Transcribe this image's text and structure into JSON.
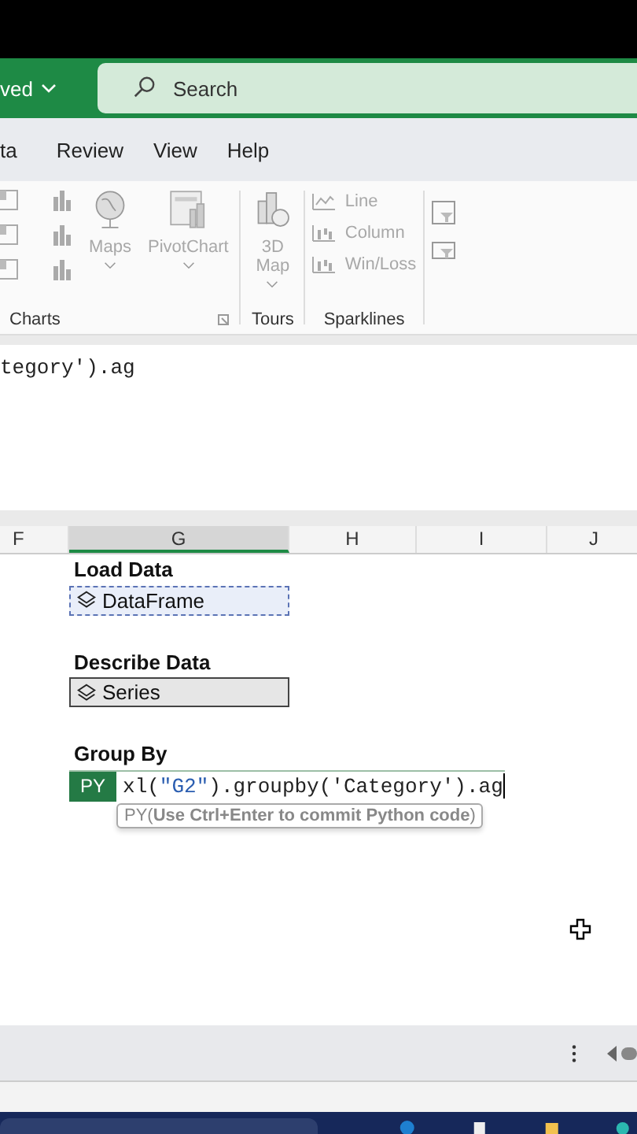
{
  "title_bar": {
    "save_status": "ved",
    "search": {
      "placeholder": "Search"
    }
  },
  "menu_tabs": [
    {
      "label": "ta",
      "selected": false
    },
    {
      "label": "Review",
      "selected": false
    },
    {
      "label": "View",
      "selected": false
    },
    {
      "label": "Help",
      "selected": false
    }
  ],
  "ribbon": {
    "groups": [
      {
        "label": "Charts",
        "buttons": [
          {
            "kind": "large",
            "label": "Maps",
            "disabled": true
          },
          {
            "kind": "large",
            "label": "PivotChart",
            "disabled": true
          }
        ]
      },
      {
        "label": "Tours",
        "buttons": [
          {
            "kind": "large",
            "label": "3D Map",
            "disabled": true
          }
        ]
      },
      {
        "label": "Sparklines",
        "buttons": [
          {
            "kind": "small",
            "label": "Line",
            "disabled": true
          },
          {
            "kind": "small",
            "label": "Column",
            "disabled": true
          },
          {
            "kind": "small",
            "label": "Win/Loss",
            "disabled": true
          }
        ]
      }
    ]
  },
  "formula_bar": {
    "text": "tegory').ag"
  },
  "columns": [
    {
      "label": "F",
      "selected": false
    },
    {
      "label": "G",
      "selected": true
    },
    {
      "label": "H",
      "selected": false
    },
    {
      "label": "I",
      "selected": false
    },
    {
      "label": "J",
      "selected": false
    }
  ],
  "cells": [
    {
      "kind": "heading",
      "text": "Load Data"
    },
    {
      "kind": "object",
      "text": "DataFrame",
      "selected": true
    },
    {
      "kind": "empty"
    },
    {
      "kind": "heading",
      "text": "Describe Data"
    },
    {
      "kind": "object",
      "text": "Series",
      "selected": false
    },
    {
      "kind": "empty"
    },
    {
      "kind": "heading",
      "text": "Group By"
    },
    {
      "kind": "editing",
      "badge": "PY",
      "parts": [
        {
          "kind": "code",
          "text": "xl("
        },
        {
          "kind": "string",
          "text": "\"G2\""
        },
        {
          "kind": "code",
          "text": ").groupby('Category').ag"
        }
      ],
      "hint": "PY(**Use Ctrl+Enter to commit Python code**)"
    }
  ]
}
